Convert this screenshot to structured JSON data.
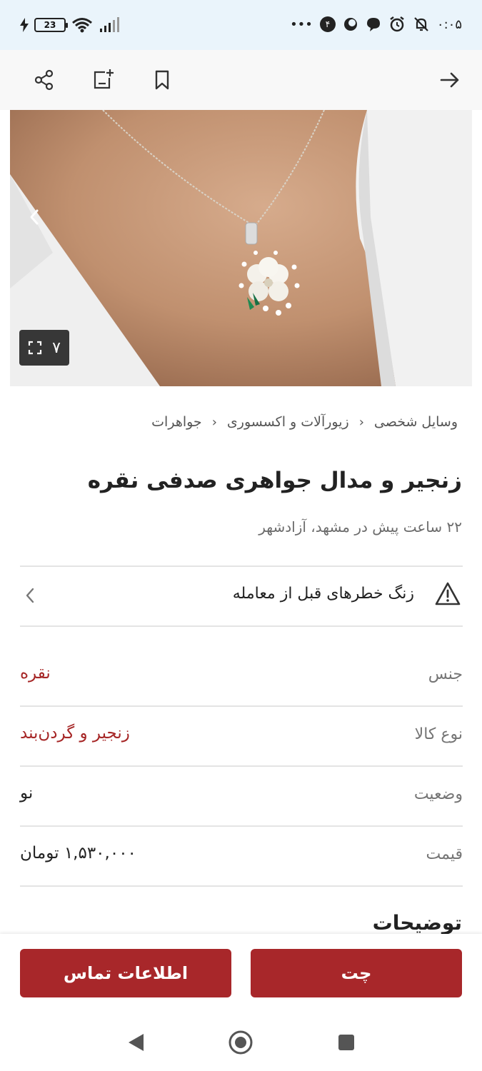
{
  "status_bar": {
    "time": "۰:۰۵",
    "battery": "23",
    "notification_count": "۴",
    "more": "•••"
  },
  "toolbar": {
    "icons": [
      "share-icon",
      "add-to-compare-icon",
      "bookmark-icon",
      "back-arrow-icon"
    ]
  },
  "gallery": {
    "count": "۷"
  },
  "breadcrumb": {
    "items": [
      "وسایل شخصی",
      "زیورآلات و اکسسوری",
      "جواهرات"
    ]
  },
  "listing": {
    "title": "زنجیر و مدال جواهری صدفی نقره",
    "subtitle": "۲۲ ساعت پیش در مشهد، آزادشهر"
  },
  "risk_warning": {
    "label": "زنگ خطرهای قبل از معامله"
  },
  "attributes": [
    {
      "label": "جنس",
      "value": "نقره",
      "highlight": true
    },
    {
      "label": "نوع کالا",
      "value": "زنجیر و گردن‌بند",
      "highlight": true
    },
    {
      "label": "وضعیت",
      "value": "نو",
      "highlight": false
    },
    {
      "label": "قیمت",
      "value": "۱,۵۳۰,۰۰۰ تومان",
      "highlight": false
    }
  ],
  "description": {
    "heading": "توضیحات"
  },
  "actions": {
    "chat_label": "چت",
    "contact_label": "اطلاعات تماس"
  },
  "colors": {
    "accent": "#a8272a",
    "value_red": "#a62626",
    "status_bar_bg": "#eaf4fb"
  }
}
